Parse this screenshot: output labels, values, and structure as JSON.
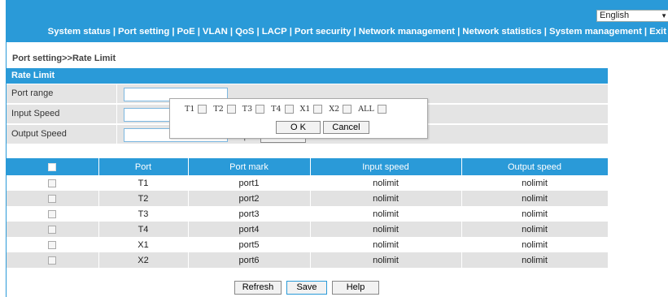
{
  "language": {
    "selected": "English"
  },
  "nav": {
    "items": [
      "System status",
      "Port setting",
      "PoE",
      "VLAN",
      "QoS",
      "LACP",
      "Port security",
      "Network management",
      "Network statistics",
      "System management",
      "Exit"
    ]
  },
  "breadcrumb": "Port setting>>Rate Limit",
  "rate_limit": {
    "title": "Rate Limit",
    "port_range_label": "Port range",
    "input_speed_label": "Input Speed",
    "output_speed_label": "Output Speed",
    "unit": "Kbps",
    "edit_label": "Edit"
  },
  "popup": {
    "ports": [
      "T1",
      "T2",
      "T3",
      "T4",
      "X1",
      "X2",
      "ALL"
    ],
    "ok_label": "O K",
    "cancel_label": "Cancel"
  },
  "table": {
    "headers": [
      "Port",
      "Port mark",
      "Input speed",
      "Output speed"
    ],
    "rows": [
      {
        "port": "T1",
        "mark": "port1",
        "input": "nolimit",
        "output": "nolimit"
      },
      {
        "port": "T2",
        "mark": "port2",
        "input": "nolimit",
        "output": "nolimit"
      },
      {
        "port": "T3",
        "mark": "port3",
        "input": "nolimit",
        "output": "nolimit"
      },
      {
        "port": "T4",
        "mark": "port4",
        "input": "nolimit",
        "output": "nolimit"
      },
      {
        "port": "X1",
        "mark": "port5",
        "input": "nolimit",
        "output": "nolimit"
      },
      {
        "port": "X2",
        "mark": "port6",
        "input": "nolimit",
        "output": "nolimit"
      }
    ]
  },
  "footer": {
    "refresh_label": "Refresh",
    "save_label": "Save",
    "help_label": "Help"
  },
  "colors": {
    "accent": "#2a9ad8",
    "row_alt": "#e2e2e2"
  }
}
